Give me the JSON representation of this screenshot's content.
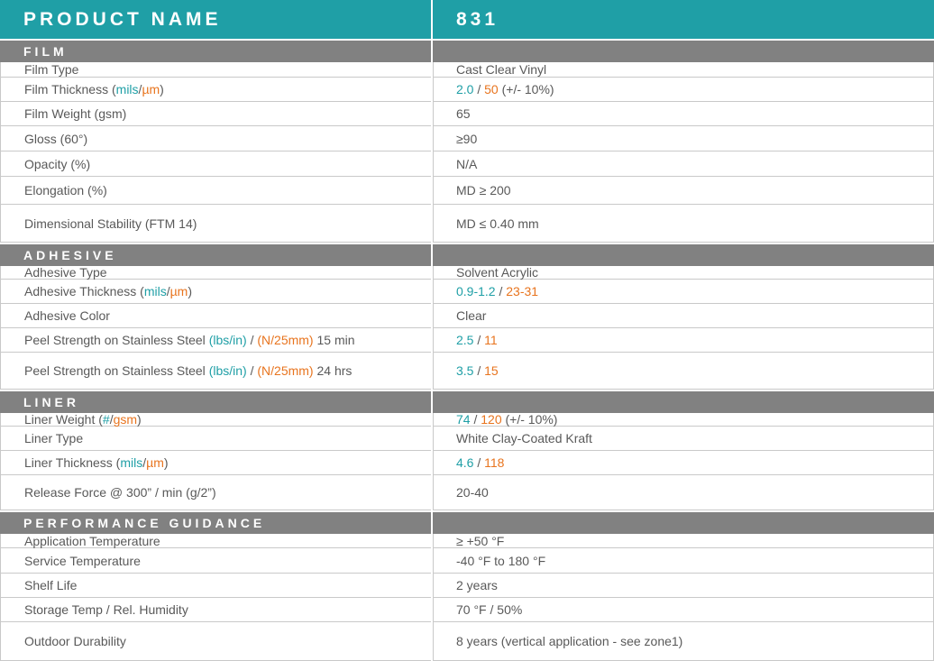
{
  "header": {
    "label": "PRODUCT NAME",
    "value": "831"
  },
  "colors": {
    "header_bg": "#1f9fa6",
    "section_bg": "#818181",
    "teal": "#1f9fa6",
    "orange": "#e8741e",
    "text": "#595959"
  },
  "sections": [
    {
      "title": "FILM",
      "rows": [
        {
          "label": [
            {
              "t": "Film Type"
            }
          ],
          "value": [
            {
              "t": "Cast Clear Vinyl"
            }
          ]
        },
        {
          "label": [
            {
              "t": "Film Thickness ("
            },
            {
              "t": "mils",
              "c": "teal"
            },
            {
              "t": "/"
            },
            {
              "t": "µm",
              "c": "orange"
            },
            {
              "t": ")"
            }
          ],
          "value": [
            {
              "t": "2.0",
              "c": "teal"
            },
            {
              "t": " / "
            },
            {
              "t": "50",
              "c": "orange"
            },
            {
              "t": " (+/- 10%)"
            }
          ]
        },
        {
          "label": [
            {
              "t": "Film Weight (gsm)"
            }
          ],
          "value": [
            {
              "t": "65"
            }
          ]
        },
        {
          "label": [
            {
              "t": "Gloss (60°)"
            }
          ],
          "value": [
            {
              "t": "≥90"
            }
          ]
        },
        {
          "label": [
            {
              "t": "Opacity (%)"
            }
          ],
          "value": [
            {
              "t": "N/A"
            }
          ]
        },
        {
          "label": [
            {
              "t": "Elongation (%)"
            }
          ],
          "value": [
            {
              "t": "MD ≥ 200"
            }
          ]
        },
        {
          "label": [
            {
              "t": "Dimensional Stability (FTM 14)"
            }
          ],
          "value": [
            {
              "t": "MD ≤ 0.40 mm"
            }
          ]
        }
      ]
    },
    {
      "title": "ADHESIVE",
      "rows": [
        {
          "label": [
            {
              "t": "Adhesive Type"
            }
          ],
          "value": [
            {
              "t": "Solvent Acrylic"
            }
          ]
        },
        {
          "label": [
            {
              "t": "Adhesive Thickness ("
            },
            {
              "t": "mils",
              "c": "teal"
            },
            {
              "t": "/"
            },
            {
              "t": "µm",
              "c": "orange"
            },
            {
              "t": ")"
            }
          ],
          "value": [
            {
              "t": "0.9-1.2",
              "c": "teal"
            },
            {
              "t": " / "
            },
            {
              "t": "23-31",
              "c": "orange"
            }
          ]
        },
        {
          "label": [
            {
              "t": "Adhesive Color"
            }
          ],
          "value": [
            {
              "t": "Clear"
            }
          ]
        },
        {
          "label": [
            {
              "t": "Peel Strength on Stainless Steel "
            },
            {
              "t": "(lbs/in)",
              "c": "teal"
            },
            {
              "t": " / "
            },
            {
              "t": "(N/25mm)",
              "c": "orange"
            },
            {
              "t": " 15 min"
            }
          ],
          "value": [
            {
              "t": "2.5",
              "c": "teal"
            },
            {
              "t": " / "
            },
            {
              "t": "11",
              "c": "orange"
            }
          ]
        },
        {
          "label": [
            {
              "t": "Peel Strength on Stainless Steel "
            },
            {
              "t": "(lbs/in)",
              "c": "teal"
            },
            {
              "t": " / "
            },
            {
              "t": "(N/25mm)",
              "c": "orange"
            },
            {
              "t": " 24 hrs"
            }
          ],
          "value": [
            {
              "t": "3.5",
              "c": "teal"
            },
            {
              "t": " / "
            },
            {
              "t": "15",
              "c": "orange"
            }
          ]
        }
      ]
    },
    {
      "title": "LINER",
      "rows": [
        {
          "label": [
            {
              "t": "Liner Weight ("
            },
            {
              "t": "#",
              "c": "teal"
            },
            {
              "t": "/"
            },
            {
              "t": "gsm",
              "c": "orange"
            },
            {
              "t": ")"
            }
          ],
          "value": [
            {
              "t": "74",
              "c": "teal"
            },
            {
              "t": " / "
            },
            {
              "t": "120",
              "c": "orange"
            },
            {
              "t": " (+/- 10%)"
            }
          ]
        },
        {
          "label": [
            {
              "t": "Liner Type"
            }
          ],
          "value": [
            {
              "t": "White Clay-Coated Kraft"
            }
          ]
        },
        {
          "label": [
            {
              "t": "Liner Thickness ("
            },
            {
              "t": "mils",
              "c": "teal"
            },
            {
              "t": "/"
            },
            {
              "t": "µm",
              "c": "orange"
            },
            {
              "t": ")"
            }
          ],
          "value": [
            {
              "t": "4.6",
              "c": "teal"
            },
            {
              "t": " / "
            },
            {
              "t": "118",
              "c": "orange"
            }
          ]
        },
        {
          "label": [
            {
              "t": "Release Force @ 300” / min (g/2”)"
            }
          ],
          "value": [
            {
              "t": "20-40"
            }
          ]
        }
      ]
    },
    {
      "title": "PERFORMANCE GUIDANCE",
      "rows": [
        {
          "label": [
            {
              "t": "Application Temperature"
            }
          ],
          "value": [
            {
              "t": "≥ +50 °F"
            }
          ]
        },
        {
          "label": [
            {
              "t": "Service Temperature"
            }
          ],
          "value": [
            {
              "t": "-40 °F to 180 °F"
            }
          ]
        },
        {
          "label": [
            {
              "t": "Shelf Life"
            }
          ],
          "value": [
            {
              "t": "2 years"
            }
          ]
        },
        {
          "label": [
            {
              "t": "Storage Temp / Rel. Humidity"
            }
          ],
          "value": [
            {
              "t": "70 °F / 50%"
            }
          ]
        },
        {
          "label": [
            {
              "t": "Outdoor Durability"
            }
          ],
          "value": [
            {
              "t": "8 years (vertical application - see zone1)"
            }
          ]
        }
      ]
    }
  ]
}
